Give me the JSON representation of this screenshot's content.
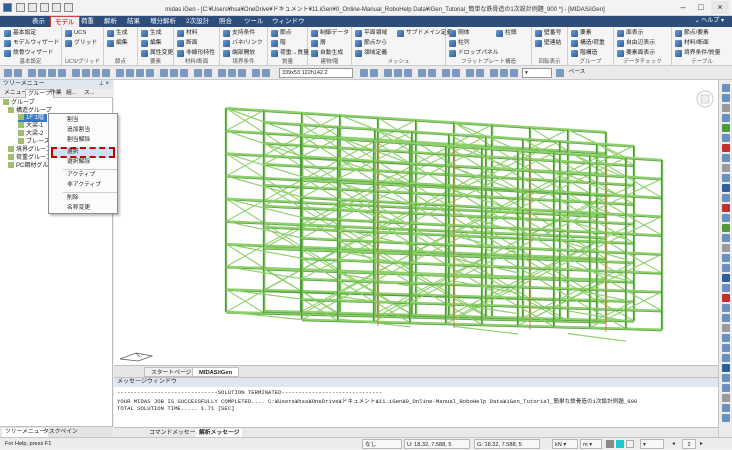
{
  "window": {
    "title": "midas iGen - [C:¥Users¥hsa¥OneDrive¥ドキュメント¥11.iGen¥0_Online-Manual_RoboHelp Data¥iGen_Tutorial_簡単な鉄骨造の1次設計例題_900 *] - [MIDAS/iGen]",
    "help_label": "ヘルプ"
  },
  "menu": {
    "items": [
      "表示",
      "モデル",
      "荷重",
      "解析",
      "結果",
      "増分解析",
      "2次設計",
      "照合",
      "ツール",
      "ウィンドウ"
    ],
    "active": "モデル"
  },
  "ribbon": {
    "groups": [
      {
        "label": "基本設定",
        "buttons": [
          "基本設定",
          "モデルウィザード",
          "鉄骨ウィザード"
        ]
      },
      {
        "label": "UCS/グリッド",
        "buttons": [
          "UCS",
          "グリッド"
        ]
      },
      {
        "label": "節点",
        "buttons": [
          "生成",
          "編集"
        ]
      },
      {
        "label": "要素",
        "buttons": [
          "生成",
          "編集",
          "属性変更"
        ]
      },
      {
        "label": "材料/断面",
        "buttons": [
          "材料",
          "断面",
          "非線形特性"
        ]
      },
      {
        "label": "境界条件",
        "buttons": [
          "支持条件",
          "バネ/リンク",
          "端部開放"
        ]
      },
      {
        "label": "質量",
        "buttons": [
          "節点",
          "階",
          "荷重→質量"
        ]
      },
      {
        "label": "建物/階",
        "buttons": [
          "制御データ",
          "層",
          "自動生成"
        ]
      },
      {
        "label": "メッシュ",
        "buttons": [
          "平面領域",
          "節点から",
          "領域定義",
          "サブドメイン定義"
        ]
      },
      {
        "label": "フラットプレート構造",
        "buttons": [
          "剛体",
          "柱列",
          "ドロップパネル",
          "柱頭"
        ]
      },
      {
        "label": "回転表示",
        "buttons": [
          "壁番号",
          "壁連結"
        ]
      },
      {
        "label": "グループ",
        "buttons": [
          "要素",
          "構造/荷重",
          "階構造"
        ]
      },
      {
        "label": "データチェック",
        "buttons": [
          "面表示",
          "自由辺表示",
          "要素面表示"
        ]
      },
      {
        "label": "テーブル",
        "buttons": [
          "節点/要素",
          "材料/断面",
          "境界条件/質量"
        ]
      }
    ]
  },
  "toolbar": {
    "coord_field": "339x53 122h142.2",
    "base_label": "ベース"
  },
  "tree": {
    "header": "ツリーメニュー",
    "tabs": [
      "メニュー",
      "グループ",
      "作業",
      "組...",
      "ス..."
    ],
    "nodes": [
      "グループ",
      "構造グループ",
      "1F:1階",
      "大梁-1",
      "大梁-2",
      "ブレース",
      "境界グループ",
      "荷重グループ",
      "PC鋼材グループ"
    ]
  },
  "context_menu": {
    "items": [
      "割当",
      "追加割当",
      "割当解除",
      "選択",
      "選択解除",
      "アクティブ",
      "非アクティブ",
      "削除",
      "名称変更"
    ],
    "highlighted": "選択"
  },
  "viewport_tabs": [
    "スタートページ",
    "MIDAS/iGen"
  ],
  "message_window": {
    "header": "メッセージウィンドウ",
    "lines": [
      "------------------------------SOLUTION TERMINATED------------------------------",
      "YOUR MIDAS JOB IS SUCCESSFULLY COMPLETED.... C:¥Users¥hsa¥OneDrive¥ドキュメント¥11.iGen¥0_Online-Manual_RoboHelp Data¥iGen_Tutorial_簡単な鉄骨造の1次設計例題_900",
      "TOTAL SOLUTION TIME.....   1.71 [SEC]"
    ],
    "tabs": [
      "コマンドメッセージ",
      "解析メッセージ"
    ]
  },
  "bottom_tabs": [
    "ツリーメニュー",
    "タスクペイン"
  ],
  "status": {
    "help": "For Help, press F1",
    "none": "なし",
    "u_coord": "U: 18.32, 7.588, 5",
    "g_coord": "G: 18.32, 7.588, 5",
    "unit_force": "kN",
    "unit_length": "m",
    "page": "2"
  },
  "colors": {
    "menubar": "#2e4d7b",
    "frame_green": "#4e9a3a",
    "frame_light": "#8ed06a",
    "highlight_dash": "#c00000"
  }
}
